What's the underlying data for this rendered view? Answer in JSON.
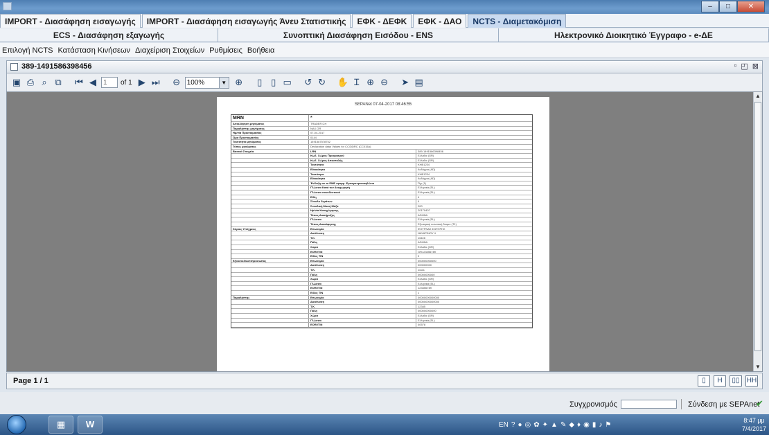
{
  "tabs_row1": [
    {
      "label": "IMPORT - Διασάφηση εισαγωγής",
      "active": false
    },
    {
      "label": "IMPORT - Διασάφηση εισαγωγής Άνευ Στατιστικής",
      "active": false
    },
    {
      "label": "ΕΦΚ - ΔΕΦΚ",
      "active": false
    },
    {
      "label": "ΕΦΚ - ΔΑΟ",
      "active": false
    },
    {
      "label": "NCTS - Διαμετακόμιση",
      "active": true
    }
  ],
  "tabs_row2": [
    {
      "label": "ECS - Διασάφηση εξαγωγής"
    },
    {
      "label": "Συνοπτική Διασάφηση Εισόδου - ENS"
    },
    {
      "label": "Ηλεκτρονικό Διοικητικό Έγγραφο - e-ΔΕ"
    }
  ],
  "menu": [
    "Επιλογή NCTS",
    "Κατάσταση Κινήσεων",
    "Διαχείριση Στοιχείων",
    "Ρυθμίσεις",
    "Βοήθεια"
  ],
  "document": {
    "title": "389-1491586398456",
    "page_input_placeholder": "1",
    "of_pages": "of 1",
    "zoom": "100%",
    "page_header": "SEPANet 07-04-2017 08:46:55",
    "mrn_label": "MRN",
    "mrn_value": "*",
    "top_rows": [
      {
        "label": "Αιτιολόγηση μηνύματος",
        "value": "TRADER.CH"
      },
      {
        "label": "Παραλήπτης μηνύματος",
        "value": "NAX.GR"
      },
      {
        "label": "Ημ/νία Προετοιμασίας",
        "value": "07-04-2017"
      },
      {
        "label": "Ώρα Προετοιμασίας",
        "value": "0144"
      },
      {
        "label": "Ταυτότητα μηνύματος",
        "value": "1491587578752"
      },
      {
        "label": "Τύπος μηνύματος",
        "value": "Declaration data/ Values for CC/DDRC (CC015A)"
      }
    ],
    "sections": [
      {
        "title": "Βασικά Στοιχεία",
        "rows": [
          {
            "label": "LRN",
            "value": "389-1491586398456"
          },
          {
            "label": "Κωδ. Χώρας Προορισμού",
            "value": "Ελλάδα (GR)"
          },
          {
            "label": "Κωδ. Χώρας Αποστολής",
            "value": "Ελλάδα (GR)"
          },
          {
            "label": "Ταυτότητα",
            "value": "KHB1234"
          },
          {
            "label": "Εθνικότητα",
            "value": "Ανδόρρα (AD)"
          },
          {
            "label": "Ταυτότητα",
            "value": "KHB1234"
          },
          {
            "label": "Εθνικότητα",
            "value": "Ανδόρρα (AD)"
          },
          {
            "label": "Ένδειξη αν το ΕΜΕ εφαρμ. Εμπορευματοκιβώτιο",
            "value": "Όχι (1)"
          },
          {
            "label": "Γλώσσα Κατά τον Αναχωρητή",
            "value": "Ελληνικά (EL)"
          },
          {
            "label": "Γλώσσα συνοδευτικού",
            "value": "Ελληνικά (EL)"
          },
          {
            "label": "Είδη",
            "value": "4"
          },
          {
            "label": "Σύνολο δεμάτων",
            "value": "4"
          },
          {
            "label": "Συνολική Μικτή Μάζα",
            "value": "200"
          },
          {
            "label": "Ημ/νία Καταχώρησης",
            "value": "20170407"
          },
          {
            "label": "Τόπος Διακήρυξης",
            "value": "ΑΘΗΝΑ"
          },
          {
            "label": "Γλώσσα",
            "value": "Ελληνικά (EL)"
          },
          {
            "label": "Τύπος Διασάφησης",
            "value": "Εξωτερική κοινοτική διαμετ.(T1)"
          }
        ]
      },
      {
        "title": "Κύριος Υπόχρεος",
        "rows": [
          {
            "label": "Επωνυμία",
            "value": "ΦΟΥΡΝΑΣ ΣΩΤΗΡΗΣ"
          },
          {
            "label": "Διεύθυνση",
            "value": "ΝΑΥΑΡΙΝΟΥ 4"
          },
          {
            "label": "Τ.Κ.",
            "value": "11528"
          },
          {
            "label": "Πόλη",
            "value": "ΑΘΗΝΑ"
          },
          {
            "label": "Χώρα",
            "value": "Ελλάδα (GR)"
          },
          {
            "label": "EORI/TIN",
            "value": "GR123456789"
          },
          {
            "label": "Είδος TIN",
            "value": "0"
          }
        ]
      },
      {
        "title": "Εξουσιοδ/Αντιπρόσωπος",
        "rows": [
          {
            "label": "Επωνυμία",
            "value": "000000000000"
          },
          {
            "label": "Διεύθυνση",
            "value": "000000000"
          },
          {
            "label": "Τ.Κ.",
            "value": "11111"
          },
          {
            "label": "Πόλη",
            "value": "00000000000"
          },
          {
            "label": "Χώρα",
            "value": "Ελλάδα (GR)"
          },
          {
            "label": "Γλώσσα",
            "value": "Ελληνικά (EL)"
          },
          {
            "label": "EORI/TIN",
            "value": "123456789"
          },
          {
            "label": "Είδος TIN",
            "value": "1"
          }
        ]
      },
      {
        "title": "Παραλήπτης",
        "rows": [
          {
            "label": "Επωνυμία",
            "value": "00000000000000"
          },
          {
            "label": "Διεύθυνση",
            "value": "00000000000000"
          },
          {
            "label": "Τ.Κ.",
            "value": "12345"
          },
          {
            "label": "Πόλη",
            "value": "000000000000"
          },
          {
            "label": "Χώρα",
            "value": "Ελλάδα (GR)"
          },
          {
            "label": "Γλώσσα",
            "value": "Ελληνικά (EL)"
          },
          {
            "label": "EORI/TIN",
            "value": "40578"
          }
        ]
      }
    ]
  },
  "status": {
    "page_label": "Page 1 / 1",
    "sync_label": "Συγχρονισμός",
    "connection_label": "Σύνδεση με SEPAnet"
  },
  "taskbar": {
    "language": "EN",
    "time": "8:47 μμ",
    "date": "7/4/2017"
  },
  "colors": {
    "active_tab": "#c9daf0",
    "viewer_bg": "#7f7f7f",
    "titlebar": "#5d8cbf"
  }
}
